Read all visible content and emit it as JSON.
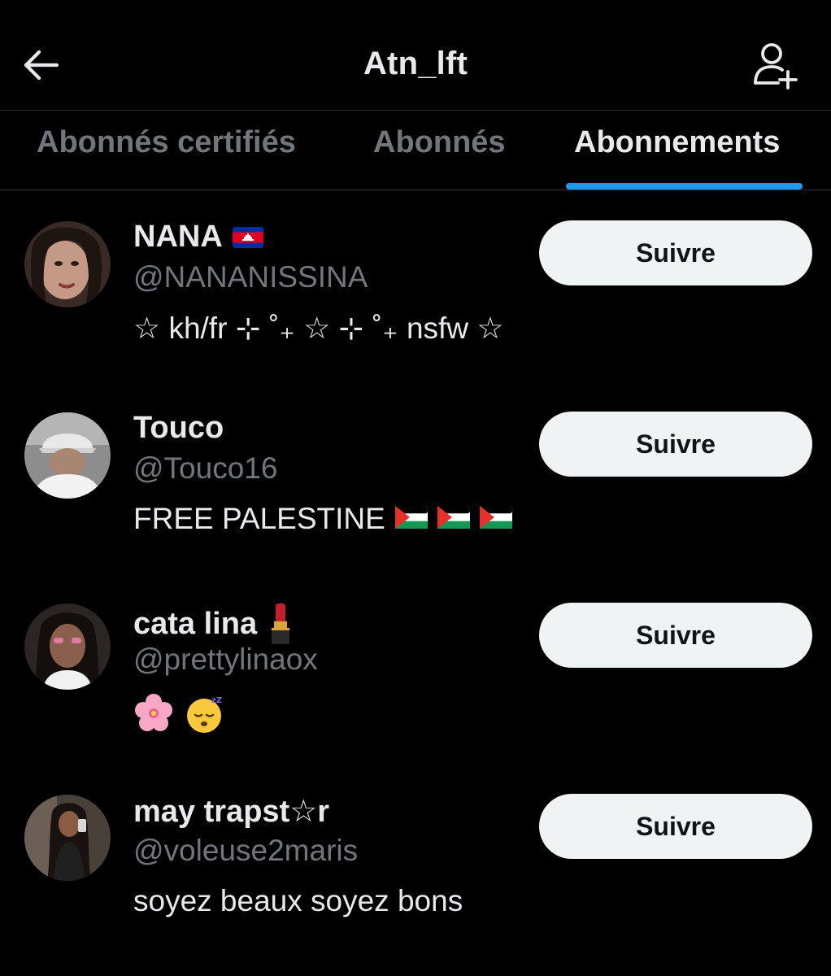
{
  "header": {
    "title": "Atn_lft",
    "back_icon": "arrow-left-icon",
    "add_user_icon": "person-add-icon"
  },
  "tabs": [
    {
      "label": "Abonnés certifiés",
      "active": false
    },
    {
      "label": "Abonnés",
      "active": false
    },
    {
      "label": "Abonnements",
      "active": true
    }
  ],
  "colors": {
    "background": "#000000",
    "text_primary": "#e7e9ea",
    "text_secondary": "#71767b",
    "accent": "#1d9bf0",
    "button_bg": "#eff3f4",
    "divider": "#2f3336"
  },
  "users": [
    {
      "name": "NANA",
      "name_emoji": "cambodia-flag",
      "handle": "@NANANISSINA",
      "bio": "☆ kh/fr ⊹ ˚₊ ☆ ⊹ ˚₊ nsfw ☆",
      "button": "Suivre"
    },
    {
      "name": "Touco",
      "handle": "@Touco16",
      "bio": "FREE PALESTINE",
      "bio_emojis": [
        "palestine-flag",
        "palestine-flag",
        "palestine-flag"
      ],
      "button": "Suivre"
    },
    {
      "name": "cata lina",
      "name_emoji": "lipstick",
      "handle": "@prettylinaox",
      "bio": "",
      "bio_emojis": [
        "cherry-blossom",
        "sleeping-face"
      ],
      "button": "Suivre"
    },
    {
      "name": "may trapst☆r",
      "handle": "@voleuse2maris",
      "bio": "soyez beaux soyez bons",
      "button": "Suivre"
    }
  ]
}
